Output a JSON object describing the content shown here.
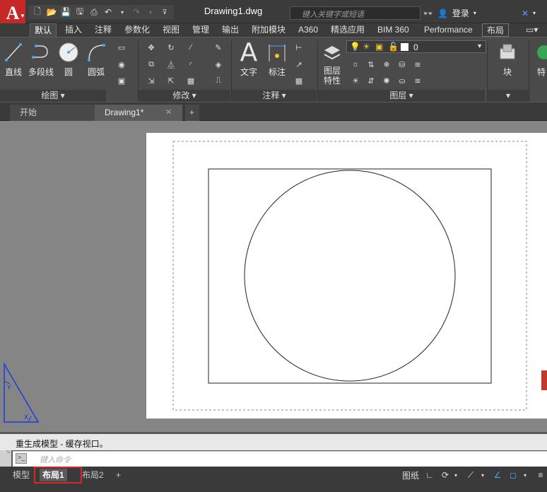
{
  "app": {
    "logo_letter": "A"
  },
  "title_bar": {
    "document_title": "Drawing1.dwg",
    "search_placeholder": "键入关键字或短语",
    "login_label": "登录"
  },
  "ribbon_tabs": [
    "默认",
    "插入",
    "注释",
    "参数化",
    "视图",
    "管理",
    "输出",
    "附加模块",
    "A360",
    "精选应用",
    "BIM 360",
    "Performance",
    "布局"
  ],
  "ribbon": {
    "draw": {
      "line": "直线",
      "polyline": "多段线",
      "circle": "圆",
      "arc": "圆弧",
      "panel": "绘图"
    },
    "modify": {
      "panel": "修改"
    },
    "annotation": {
      "text": "文字",
      "dimension": "标注",
      "panel": "注释"
    },
    "layers": {
      "properties": "图层\n特性",
      "properties_l1": "图层",
      "properties_l2": "特性",
      "current_layer": "0",
      "panel": "图层"
    },
    "block": {
      "insert": "块"
    },
    "partial": {
      "label": "特"
    }
  },
  "doc_tabs": {
    "start": "开始",
    "drawing": "Drawing1*"
  },
  "command": {
    "history": "重生成模型 - 缓存视口。",
    "placeholder": "键入命令"
  },
  "layout_tabs": {
    "model": "模型",
    "layout1": "布局1",
    "layout2": "布局2"
  },
  "status": {
    "paper": "图纸"
  },
  "colors": {
    "accent": "#c62828",
    "highlight": "#d62828",
    "ucs": "#1a3fd6"
  }
}
